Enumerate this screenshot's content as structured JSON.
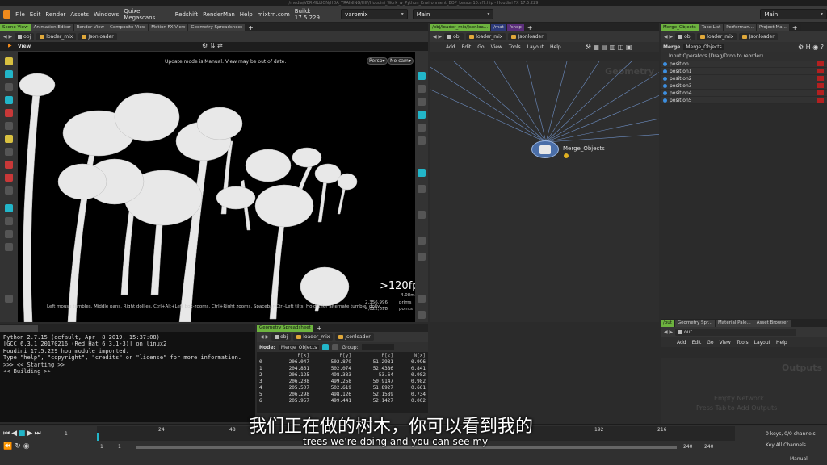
{
  "window": {
    "title": "/media/VERMILLION/HDA_TRAINING/HIP/Houdini_Work_w_Python_Environment_BOP_Lesson10.vf7.hip - Houdini FX 17.5.229"
  },
  "menubar": {
    "items": [
      "File",
      "Edit",
      "Render",
      "Assets",
      "Windows",
      "Quixel Megascans",
      "Redshift",
      "RenderMan",
      "Help",
      "mixtrn.com",
      "Build: 17.5.229"
    ],
    "desktop": "varomix",
    "desktop2": "Main",
    "desktop3": "Main"
  },
  "left_panel": {
    "tabs": [
      "Scene View",
      "Animation Editor",
      "Render View",
      "Composite View",
      "Motion FX View",
      "Geometry Spreadsheet"
    ],
    "path": [
      "obj",
      "loader_mix",
      "Jsonloader"
    ],
    "view_label": "View",
    "update_msg": "Update mode is Manual. View may be out of date.",
    "persp": "Persp",
    "cam": "No cam",
    "fps": ">120fps",
    "fps_ms": "4.08ms",
    "prims": "2,356,996",
    "prims_label": "prims",
    "points": "4,022,898",
    "points_label": "points",
    "hint": "Left mouse tumbles. Middle pans. Right dollies. Ctrl+Alt+Left box-zooms. Ctrl+Right zooms. Spacebar-Ctrl-Left tilts. Hold L for alternate tumble, dolly, ..."
  },
  "network_panel": {
    "tabs": [
      "/obj/loader_mix/Jsonloa...",
      "/mat",
      "/shop"
    ],
    "path": [
      "obj",
      "loader_mix",
      "Jsonloader"
    ],
    "menu": [
      "Add",
      "Edit",
      "Go",
      "View",
      "Tools",
      "Layout",
      "Help"
    ],
    "watermark": "Geometry",
    "node_name": "Merge_Objects"
  },
  "params_panel": {
    "tabs": [
      "Merge_Objects",
      "Take List",
      "Performan...",
      "Project Ma..."
    ],
    "path": [
      "obj",
      "loader_mix",
      "Jsonloader"
    ],
    "node_type": "Merge",
    "node_name": "Merge_Objects",
    "operators_label": "Input Operators (Drag/Drop to reorder)",
    "inputs": [
      "position",
      "position1",
      "position2",
      "position3",
      "position4",
      "position5"
    ]
  },
  "out_panel": {
    "tabs": [
      "/out",
      "Geometry Spr...",
      "Material Pale...",
      "Asset Browser"
    ],
    "path": "out",
    "menu": [
      "Add",
      "Edit",
      "Go",
      "View",
      "Tools",
      "Layout",
      "Help"
    ],
    "watermark": "Outputs",
    "empty1": "Empty Network",
    "empty2": "Press Tab to Add Outputs"
  },
  "console": {
    "lines": [
      "Python 2.7.15 (default, Apr  8 2019, 15:37:08)",
      "[GCC 6.3.1 20170216 (Red Hat 6.3.1-3)] on linux2",
      "Houdini 17.5.229 hou module imported.",
      "Type \"help\", \"copyright\", \"credits\" or \"license\" for more information.",
      ">>> << Starting >>",
      "<< Building >>"
    ]
  },
  "spreadsheet": {
    "tab": "Geometry Spreadsheet",
    "path": [
      "obj",
      "loader_mix",
      "Jsonloader"
    ],
    "node_label": "Node:",
    "node": "Merge_Objects",
    "group_label": "Group:",
    "columns": [
      "",
      "P[x]",
      "P[y]",
      "P[z]",
      "N[x]"
    ],
    "rows": [
      [
        "0",
        "206.047",
        "502.879",
        "51.2981",
        "0.996"
      ],
      [
        "1",
        "204.861",
        "502.074",
        "52.4386",
        "0.841"
      ],
      [
        "2",
        "206.125",
        "498.333",
        "53.64",
        "0.982"
      ],
      [
        "3",
        "206.208",
        "499.258",
        "50.9147",
        "0.982"
      ],
      [
        "4",
        "205.507",
        "502.619",
        "51.8927",
        "0.661"
      ],
      [
        "5",
        "206.298",
        "498.126",
        "52.1589",
        "0.734"
      ],
      [
        "6",
        "205.957",
        "499.441",
        "52.1427",
        "0.002"
      ]
    ]
  },
  "timeline": {
    "ticks": [
      "24",
      "48",
      "192",
      "216"
    ],
    "start": "1",
    "start2": "1",
    "end": "240",
    "end2": "240",
    "keys": "0 keys, 0/0 channels",
    "key_all": "Key All Channels",
    "manual": "Manual"
  },
  "subtitles": {
    "cn": "我们正在做的树木，你可以看到我的",
    "en": "trees we're doing and you can see my"
  }
}
